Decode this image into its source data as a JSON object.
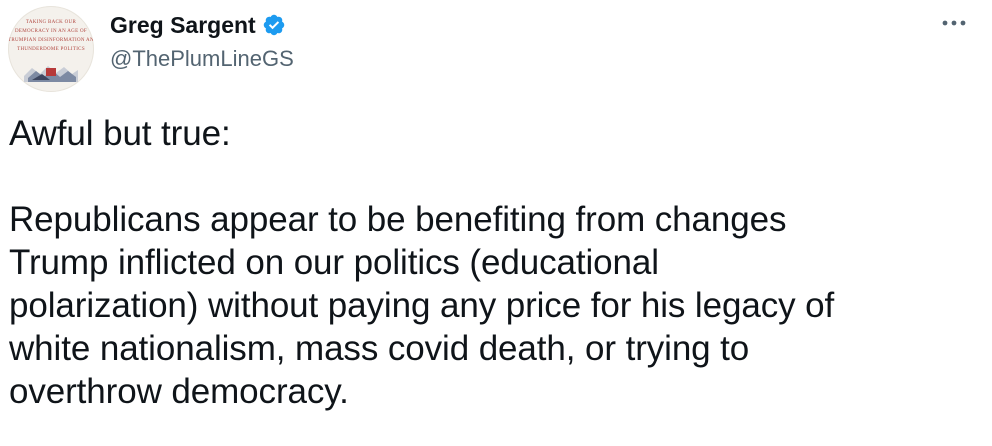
{
  "author": {
    "display_name": "Greg Sargent",
    "handle": "@ThePlumLineGS",
    "verified_color": "#1d9bf0",
    "avatar_cover_lines": [
      "TAKING BACK OUR",
      "DEMOCRACY IN AN AGE OF",
      "TRUMPIAN DISINFORMATION AND",
      "THUNDERDOME POLITICS"
    ]
  },
  "menu": {
    "icon": "more-horizontal-icon"
  },
  "tweet": {
    "intro": "Awful but true:",
    "lines": [
      "Republicans appear to be benefiting from changes",
      "Trump inflicted on our politics (educational",
      "polarization) without paying any price for his legacy of",
      "white nationalism, mass covid death, or trying to",
      "overthrow democracy."
    ]
  },
  "colors": {
    "text": "#0f1419",
    "secondary": "#536471",
    "accent": "#1d9bf0"
  }
}
